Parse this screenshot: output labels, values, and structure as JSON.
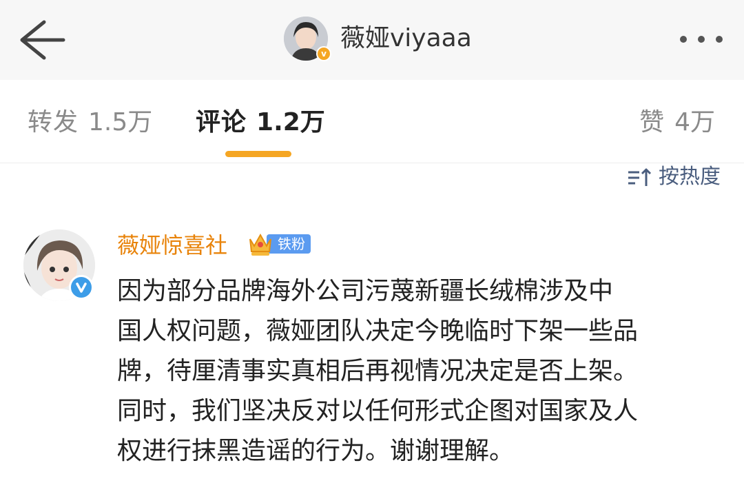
{
  "header": {
    "back_icon": "arrow-left-icon",
    "username": "薇娅viyaaa",
    "more_icon": "more-dots-icon"
  },
  "tabs": [
    {
      "label": "转发",
      "count": "1.5万",
      "active": false
    },
    {
      "label": "评论",
      "count": "1.2万",
      "active": true
    },
    {
      "label": "赞",
      "count": "4万",
      "active": false
    }
  ],
  "sort": {
    "label": "按热度",
    "icon": "sort-icon"
  },
  "comment": {
    "author": "薇娅惊喜社",
    "fan_badge": "铁粉",
    "verified": true,
    "lines": [
      "因为部分品牌海外公司污蔑新疆长绒棉涉及中",
      "国人权问题，薇娅团队决定今晚临时下架一些品",
      "牌，待厘清事实真相后再视情况决定是否上架。",
      "同时，我们坚决反对以任何形式企图对国家及人",
      "权进行抹黑造谣的行为。谢谢理解。"
    ]
  },
  "colors": {
    "accent": "#f5a623",
    "author_name": "#e8830a",
    "sort_text": "#4a5d7e",
    "fan_badge": "#5b9bf0",
    "verified": "#3d9de8"
  }
}
